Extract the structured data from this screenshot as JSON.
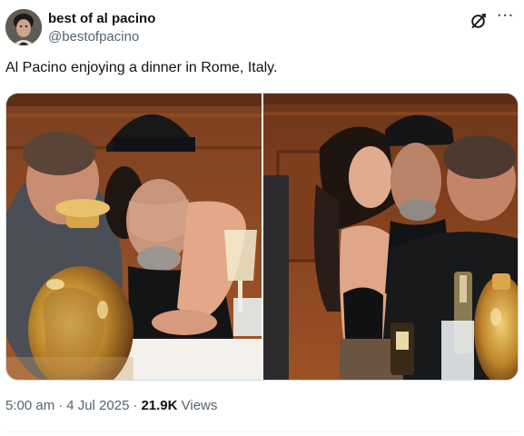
{
  "author": {
    "display_name": "best of al pacino",
    "handle": "@bestofpacino",
    "avatar_icon": "profile-photo"
  },
  "header_actions": {
    "grok_icon": "grok-icon",
    "more_icon": "more-icon",
    "more_label": "···"
  },
  "tweet": {
    "text": "Al Pacino enjoying a dinner in Rome, Italy."
  },
  "media": {
    "count": 2
  },
  "meta": {
    "time": "5:00 am",
    "date": "4 Jul 2025",
    "separator": "·",
    "views_count": "21.9K",
    "views_label": "Views"
  },
  "colors": {
    "text_primary": "#0f1419",
    "text_secondary": "#536471",
    "border": "#cfd9de",
    "divider": "#eff3f4"
  }
}
